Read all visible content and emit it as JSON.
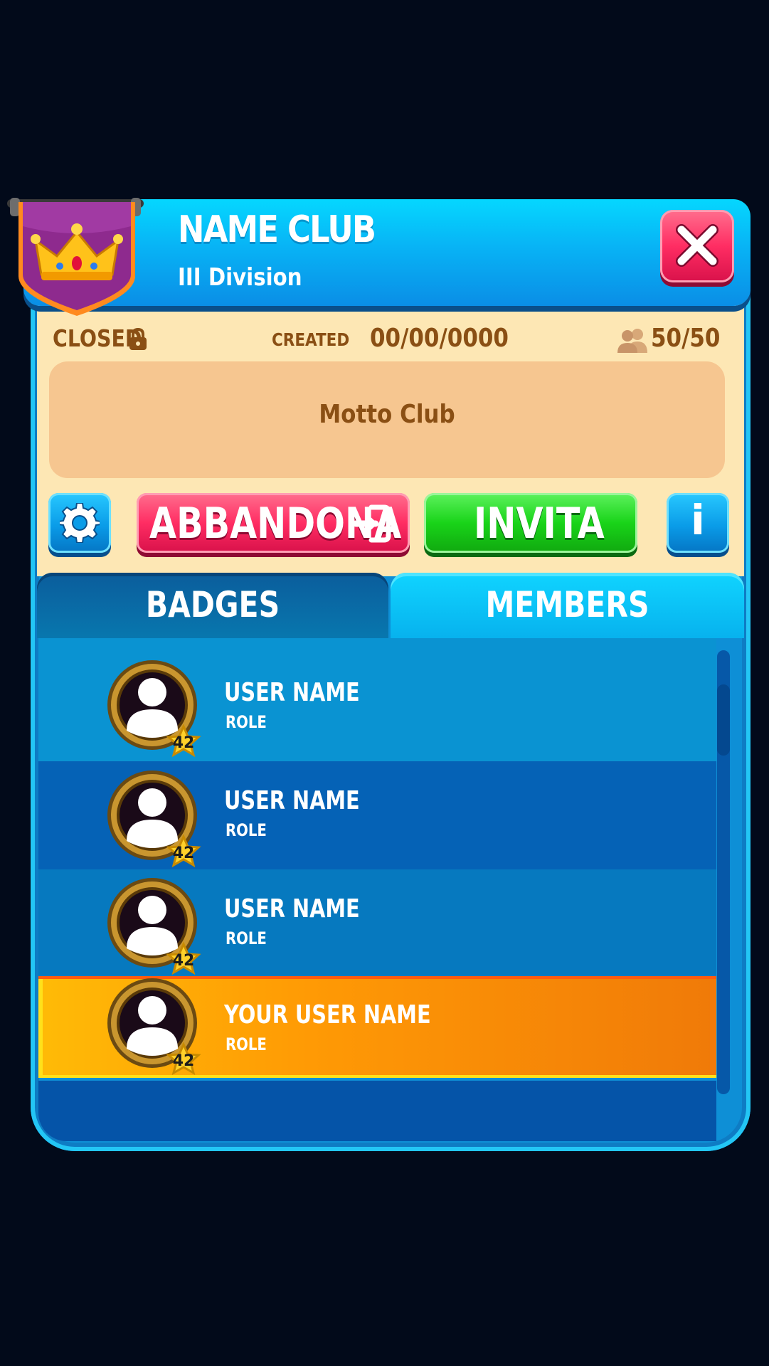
{
  "header": {
    "club_name": "NAME CLUB",
    "division": "III Division",
    "emblem": "crown-shield-icon",
    "close_icon": "close-icon"
  },
  "info": {
    "status": "CLOSED",
    "created_label": "CREATED",
    "created_date": "00/00/0000",
    "members_count": "50/50",
    "motto": "Motto Club"
  },
  "actions": {
    "settings_icon": "gear-icon",
    "leave_label": "ABBANDONA",
    "leave_icon": "exit-icon",
    "invite_label": "INVITA",
    "info_label": "i"
  },
  "tabs": [
    {
      "label": "BADGES",
      "active": false
    },
    {
      "label": "MEMBERS",
      "active": true
    }
  ],
  "members": [
    {
      "name": "USER NAME",
      "role": "ROLE",
      "level": "42",
      "is_self": false
    },
    {
      "name": "USER NAME",
      "role": "ROLE",
      "level": "42",
      "is_self": false
    },
    {
      "name": "USER NAME",
      "role": "ROLE",
      "level": "42",
      "is_self": false
    },
    {
      "name": "YOUR USER NAME",
      "role": "ROLE",
      "level": "42",
      "is_self": true
    }
  ],
  "colors": {
    "header_blue": "#08b3f5",
    "panel_cream": "#fde7b4",
    "motto_box": "#f6c690",
    "text_brown": "#8a4f14",
    "leave_red": "#ff2d63",
    "invite_green": "#19d419",
    "self_row_orange": "#ff9a05"
  }
}
